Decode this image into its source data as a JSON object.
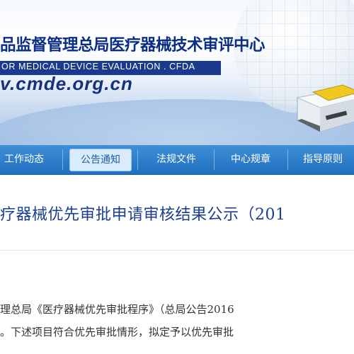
{
  "header": {
    "cn_title": "品监督管理总局医疗器械技术审评中心",
    "en_title": "OR MEDICAL DEVICE EVALUATION . CFDA",
    "url": "v.cmde.org.cn"
  },
  "nav": {
    "items": [
      {
        "label": "工作动态"
      },
      {
        "label": "公告通知"
      },
      {
        "label": "法规文件"
      },
      {
        "label": "中心规章"
      },
      {
        "label": "指导原则"
      }
    ],
    "active": "公告通知"
  },
  "article": {
    "title": "疗器械优先审批申请审核结果公示（201",
    "paragraph_line1": "理总局《医疗器械优先审批程序》（总局公告2016",
    "paragraph_line2": "。下述项目符合优先审批情形，拟定予以优先审批"
  },
  "colors": {
    "nav_bg": "#1f6fc0",
    "title_text": "#0a2e86",
    "headline_text": "#1b3f8f"
  }
}
